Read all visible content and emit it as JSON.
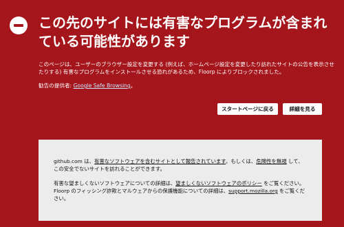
{
  "page": {
    "title": "この先のサイトには有害なプログラムが含まれている可能性があります",
    "description": "このページは、ユーザーのブラウザー設定を変更する (例えば、ホームページ設定を変更したり訪れたサイトの公告を表示させたりする) 有害なプログラムをインストールさせる恐れがあるため、Floorp によりブロックされました。",
    "provider_label": "勧告の提供者:",
    "provider_link": "Google Safe Browsing",
    "provider_suffix": "。"
  },
  "buttons": {
    "back_label": "スタートページに戻る",
    "details_label": "詳細を見る"
  },
  "details": {
    "p1": {
      "t1": "github.com は、",
      "l1": "有害なソフトウェアを含むサイトとして報告されています",
      "t2": "。もしくは、",
      "l2": "危険性を無視",
      "t3": " して、この安全でないサイトを訪れることができます。"
    },
    "p2": {
      "t1": "有害な望ましくないソフトウェアについての詳細は、",
      "l1": "望ましくないソフトウェアのポリシー",
      "t2": " をご覧ください。Floorp のフィッシング詐欺とマルウェアからの保護機能についての詳細は、",
      "l2": "support.mozilla.org",
      "t3": " をご覧ください。"
    }
  }
}
